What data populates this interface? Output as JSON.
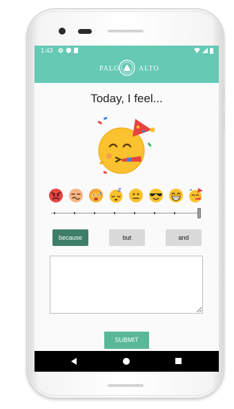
{
  "status_bar": {
    "time": "1:43",
    "left_icons": [
      "gear-icon",
      "shield-icon",
      "sd-card-icon"
    ],
    "right_icons": [
      "wifi-icon",
      "signal-icon",
      "battery-icon"
    ]
  },
  "app_bar": {
    "logo_left": "PALO",
    "logo_right": "ALTO",
    "logo_seal": "city-seal-icon",
    "color": "#66c9b4"
  },
  "main": {
    "title": "Today, I feel...",
    "selected_mood": "partying-face",
    "mood_options": [
      "angry-face",
      "dizzy-face",
      "hot-face",
      "sleeping-face",
      "neutral-face",
      "sunglasses-face",
      "grinning-face",
      "partying-face"
    ],
    "slider": {
      "steps": 8,
      "value_index": 7
    },
    "word_buttons": [
      {
        "label": "because",
        "active": true
      },
      {
        "label": "but",
        "active": false
      },
      {
        "label": "and",
        "active": false
      }
    ],
    "text_input": {
      "value": "",
      "placeholder": ""
    },
    "submit_label": "SUBMIT"
  },
  "nav_bar": {
    "buttons": [
      "back-icon",
      "home-icon",
      "recents-icon"
    ]
  },
  "colors": {
    "accent": "#66c9b4",
    "active_button": "#3e7e68",
    "submit": "#5ab898",
    "inactive_button": "#d9d9d9"
  }
}
